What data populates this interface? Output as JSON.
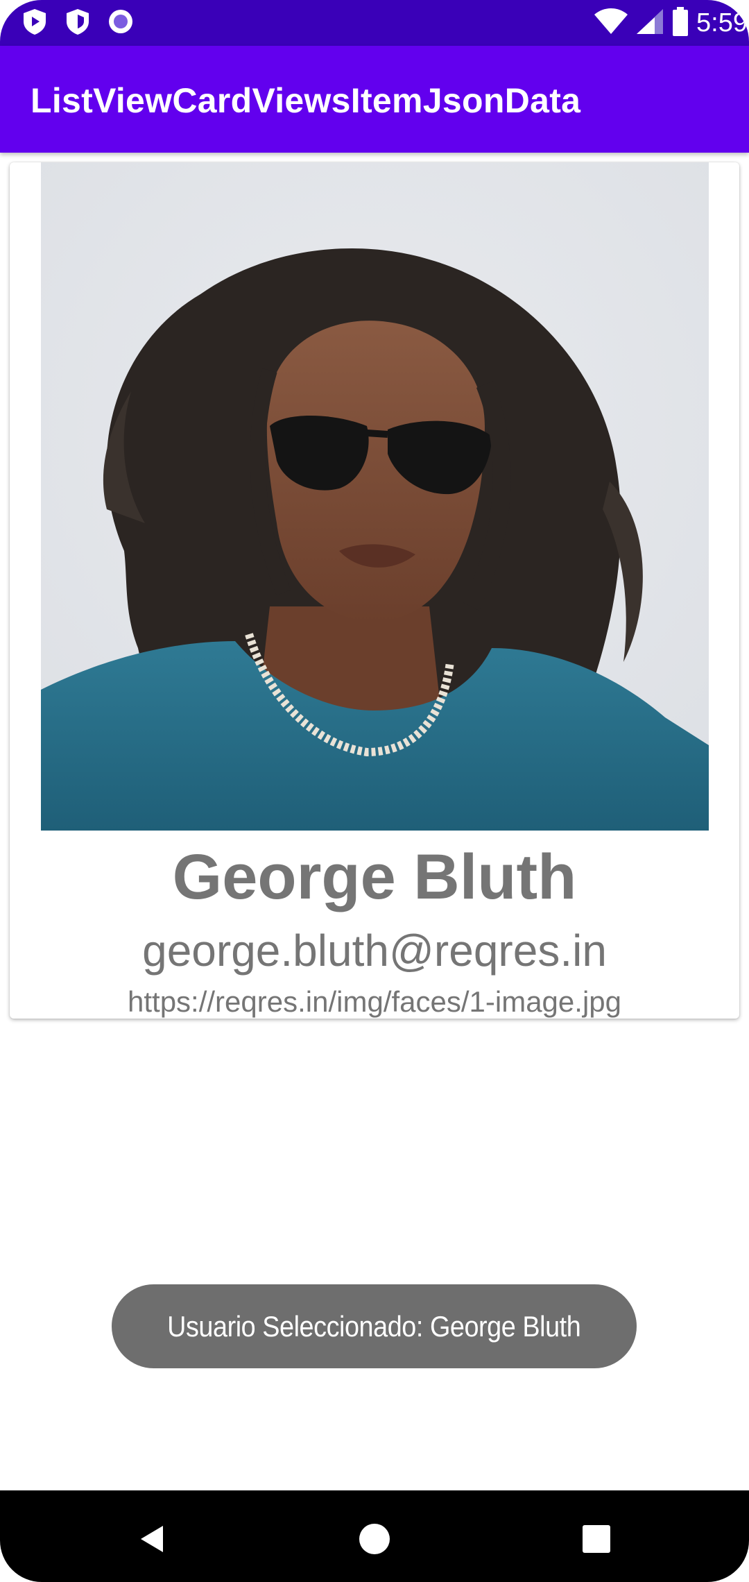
{
  "status_bar": {
    "time": "5:59",
    "icons": [
      "play-protect-icon",
      "shield-icon",
      "notification-dot-icon",
      "wifi-icon",
      "signal-icon",
      "battery-icon"
    ]
  },
  "app_bar": {
    "title": "ListViewCardViewsItemJsonData"
  },
  "colors": {
    "status_bar": "#3a00b8",
    "app_bar": "#6200ee",
    "text_secondary": "#757575",
    "toast_bg": "#6e6e6e",
    "nav_bar": "#000000"
  },
  "card": {
    "name": "George Bluth",
    "email": "george.bluth@reqres.in",
    "avatar_url": "https://reqres.in/img/faces/1-image.jpg",
    "photo_alt": "user-photo"
  },
  "toast": {
    "message": "Usuario Seleccionado: George Bluth"
  },
  "nav_bar": {
    "icons": [
      "back-icon",
      "home-icon",
      "recents-icon"
    ]
  }
}
